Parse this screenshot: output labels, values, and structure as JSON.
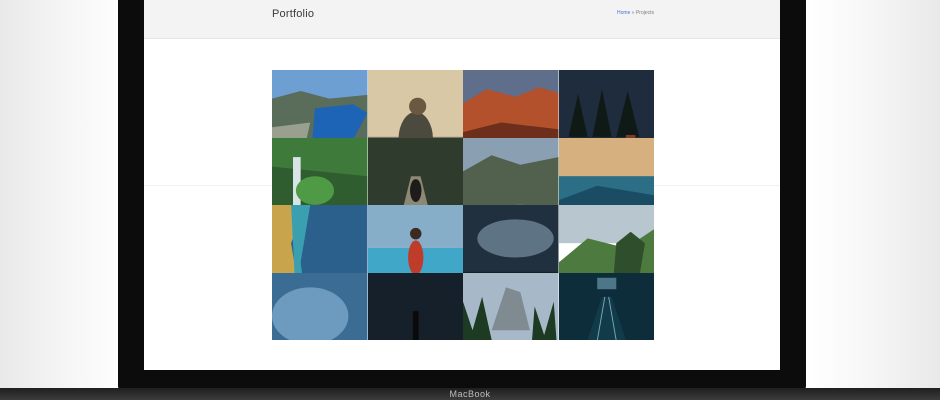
{
  "device": {
    "label": "MacBook"
  },
  "header": {
    "title": "Portfolio",
    "breadcrumb": {
      "home": "Home",
      "separator": "»",
      "current": "Projects"
    },
    "link_color": "#4f6fd8"
  },
  "gallery": {
    "tiles": [
      "Fjord canyon landscape",
      "Hiker on mountaintop at sunrise",
      "Red rock canyon at sunset",
      "Snowy forest cabin",
      "Waterfall in green valley",
      "Person on wooden bridge in forest",
      "Mountain lake valley",
      "Ocean wave at dusk",
      "Aerial coastline with turquoise water",
      "Woman in canoe on lake",
      "Stormy sky over water",
      "Green cliffs and hills",
      "Crashing ocean wave",
      "Figure walking in dark water",
      "Forest valley with granite mountains",
      "Modern building corridor"
    ]
  }
}
